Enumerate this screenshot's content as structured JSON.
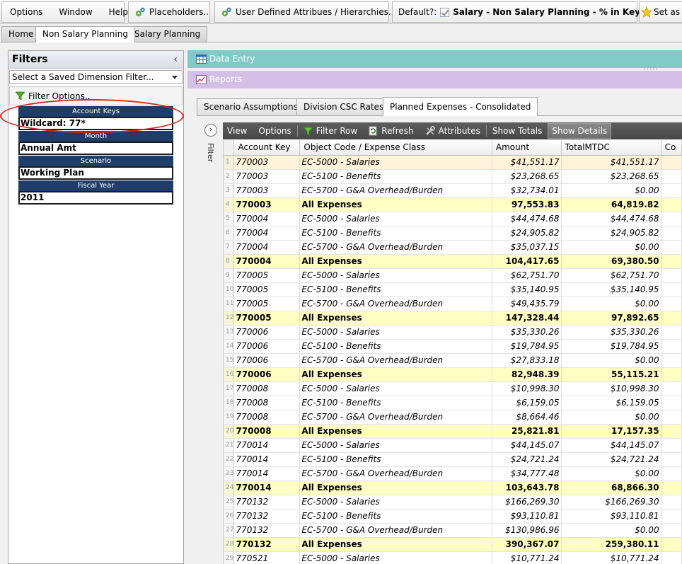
{
  "toolbar": {
    "menus": [
      "Options",
      "Window",
      "Help"
    ],
    "placeholders_label": "Placeholders..",
    "uda_label": "User Defined Attribues / Hierarchies..",
    "default_label": "Default?:",
    "layout_label": "Salary - Non Salary Planning - % in Key",
    "set_as_label": "Set as D"
  },
  "module_tabs": [
    "Home",
    "Non Salary Planning",
    "Salary Planning"
  ],
  "filters": {
    "title": "Filters",
    "saved_filter_placeholder": "Select a Saved Dimension Filter...",
    "options_label": "Filter Options..",
    "dimensions": [
      {
        "name": "Account Keys",
        "value": "Wildcard: 77*"
      },
      {
        "name": "Month",
        "value": "Annual Amt"
      },
      {
        "name": "Scenario",
        "value": "Working Plan"
      },
      {
        "name": "Fiscal Year",
        "value": "2011"
      }
    ]
  },
  "panels": {
    "data_entry": "Data Entry",
    "reports": "Reports",
    "grip": "....."
  },
  "sub_tabs": [
    "Scenario Assumptions",
    "Division CSC Rates",
    "Planned Expenses - Consolidated"
  ],
  "side_filter": {
    "label": "Filter",
    "toggle": "›"
  },
  "grid_toolbar": {
    "view": "View",
    "options": "Options",
    "filter_row": "Filter Row",
    "refresh": "Refresh",
    "attributes": "Attributes",
    "show_totals": "Show Totals",
    "show_details": "Show Details"
  },
  "grid": {
    "columns": [
      "Account Key",
      "Object Code / Expense Class",
      "Amount",
      "TotalMTDC",
      "Co"
    ],
    "rows": [
      {
        "n": "1",
        "key": "770003",
        "code": "EC-5000 -  Salaries",
        "amount": "$41,551.17",
        "mtdc": "$41,551.17",
        "total": false
      },
      {
        "n": "2",
        "key": "770003",
        "code": "EC-5100 -  Benefits",
        "amount": "$23,268.65",
        "mtdc": "$23,268.65",
        "total": false
      },
      {
        "n": "3",
        "key": "770003",
        "code": "EC-5700 -  G&A Overhead/Burden",
        "amount": "$32,734.01",
        "mtdc": "$0.00",
        "total": false
      },
      {
        "n": "4",
        "key": "770003",
        "code": "All Expenses",
        "amount": "97,553.83",
        "mtdc": "64,819.82",
        "total": true
      },
      {
        "n": "5",
        "key": "770004",
        "code": "EC-5000 -  Salaries",
        "amount": "$44,474.68",
        "mtdc": "$44,474.68",
        "total": false
      },
      {
        "n": "6",
        "key": "770004",
        "code": "EC-5100 -  Benefits",
        "amount": "$24,905.82",
        "mtdc": "$24,905.82",
        "total": false
      },
      {
        "n": "7",
        "key": "770004",
        "code": "EC-5700 -  G&A Overhead/Burden",
        "amount": "$35,037.15",
        "mtdc": "$0.00",
        "total": false
      },
      {
        "n": "8",
        "key": "770004",
        "code": "All Expenses",
        "amount": "104,417.65",
        "mtdc": "69,380.50",
        "total": true
      },
      {
        "n": "9",
        "key": "770005",
        "code": "EC-5000 -  Salaries",
        "amount": "$62,751.70",
        "mtdc": "$62,751.70",
        "total": false
      },
      {
        "n": "10",
        "key": "770005",
        "code": "EC-5100 -  Benefits",
        "amount": "$35,140.95",
        "mtdc": "$35,140.95",
        "total": false
      },
      {
        "n": "11",
        "key": "770005",
        "code": "EC-5700 -  G&A Overhead/Burden",
        "amount": "$49,435.79",
        "mtdc": "$0.00",
        "total": false
      },
      {
        "n": "12",
        "key": "770005",
        "code": "All Expenses",
        "amount": "147,328.44",
        "mtdc": "97,892.65",
        "total": true
      },
      {
        "n": "13",
        "key": "770006",
        "code": "EC-5000 -  Salaries",
        "amount": "$35,330.26",
        "mtdc": "$35,330.26",
        "total": false
      },
      {
        "n": "14",
        "key": "770006",
        "code": "EC-5100 -  Benefits",
        "amount": "$19,784.95",
        "mtdc": "$19,784.95",
        "total": false
      },
      {
        "n": "15",
        "key": "770006",
        "code": "EC-5700 -  G&A Overhead/Burden",
        "amount": "$27,833.18",
        "mtdc": "$0.00",
        "total": false
      },
      {
        "n": "16",
        "key": "770006",
        "code": "All Expenses",
        "amount": "82,948.39",
        "mtdc": "55,115.21",
        "total": true
      },
      {
        "n": "17",
        "key": "770008",
        "code": "EC-5000 -  Salaries",
        "amount": "$10,998.30",
        "mtdc": "$10,998.30",
        "total": false
      },
      {
        "n": "18",
        "key": "770008",
        "code": "EC-5100 -  Benefits",
        "amount": "$6,159.05",
        "mtdc": "$6,159.05",
        "total": false
      },
      {
        "n": "19",
        "key": "770008",
        "code": "EC-5700 -  G&A Overhead/Burden",
        "amount": "$8,664.46",
        "mtdc": "$0.00",
        "total": false
      },
      {
        "n": "20",
        "key": "770008",
        "code": "All Expenses",
        "amount": "25,821.81",
        "mtdc": "17,157.35",
        "total": true
      },
      {
        "n": "21",
        "key": "770014",
        "code": "EC-5000 -  Salaries",
        "amount": "$44,145.07",
        "mtdc": "$44,145.07",
        "total": false
      },
      {
        "n": "22",
        "key": "770014",
        "code": "EC-5100 -  Benefits",
        "amount": "$24,721.24",
        "mtdc": "$24,721.24",
        "total": false
      },
      {
        "n": "23",
        "key": "770014",
        "code": "EC-5700 -  G&A Overhead/Burden",
        "amount": "$34,777.48",
        "mtdc": "$0.00",
        "total": false
      },
      {
        "n": "24",
        "key": "770014",
        "code": "All Expenses",
        "amount": "103,643.78",
        "mtdc": "68,866.30",
        "total": true
      },
      {
        "n": "25",
        "key": "770132",
        "code": "EC-5000 -  Salaries",
        "amount": "$166,269.30",
        "mtdc": "$166,269.30",
        "total": false
      },
      {
        "n": "26",
        "key": "770132",
        "code": "EC-5100 -  Benefits",
        "amount": "$93,110.81",
        "mtdc": "$93,110.81",
        "total": false
      },
      {
        "n": "27",
        "key": "770132",
        "code": "EC-5700 -  G&A Overhead/Burden",
        "amount": "$130,986.96",
        "mtdc": "$0.00",
        "total": false
      },
      {
        "n": "28",
        "key": "770132",
        "code": "All Expenses",
        "amount": "390,367.07",
        "mtdc": "259,380.11",
        "total": true
      },
      {
        "n": "29",
        "key": "770521",
        "code": "EC-5000 -  Salaries",
        "amount": "$10,771.24",
        "mtdc": "$10,771.24",
        "total": false
      }
    ]
  },
  "colors": {
    "data_entry_bar": "#7ecbc8",
    "reports_bar": "#d4c0e6",
    "dimension_header": "#1f3d6b",
    "total_row": "#ffffc4",
    "highlight_ellipse": "#d9241c"
  }
}
